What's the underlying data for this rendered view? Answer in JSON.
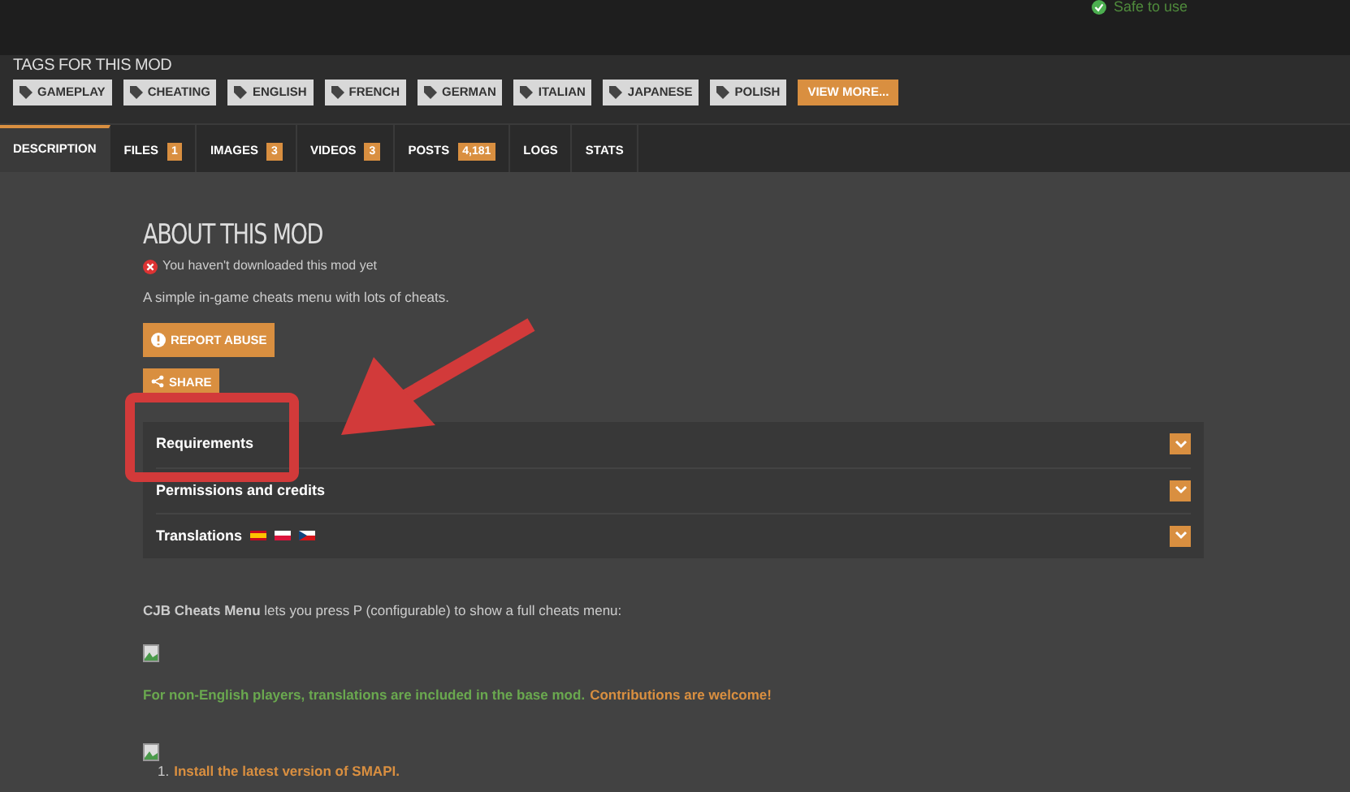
{
  "header": {
    "safety": "Safe to use"
  },
  "tags": {
    "title": "TAGS FOR THIS MOD",
    "items": [
      "GAMEPLAY",
      "CHEATING",
      "ENGLISH",
      "FRENCH",
      "GERMAN",
      "ITALIAN",
      "JAPANESE",
      "POLISH"
    ],
    "more": "VIEW MORE..."
  },
  "tabs": [
    {
      "label": "DESCRIPTION",
      "selected": true
    },
    {
      "label": "FILES",
      "count": "1",
      "selected": false
    },
    {
      "label": "IMAGES",
      "count": "3",
      "selected": false
    },
    {
      "label": "VIDEOS",
      "count": "3",
      "selected": false
    },
    {
      "label": "POSTS",
      "count": "4,181",
      "selected": false
    },
    {
      "label": "LOGS",
      "selected": false
    },
    {
      "label": "STATS",
      "selected": false
    }
  ],
  "about": {
    "title": "ABOUT THIS MOD",
    "download_status": "You haven't downloaded this mod yet",
    "summary": "A simple in-game cheats menu with lots of cheats.",
    "buttons": [
      "REPORT ABUSE",
      "SHARE"
    ]
  },
  "sections": [
    {
      "label": "Requirements",
      "kind": "plain",
      "expanded": false
    },
    {
      "label": "Permissions and credits",
      "kind": "plain",
      "expanded": false
    },
    {
      "label": "Translations",
      "kind": "flags",
      "expanded": false
    }
  ],
  "description": {
    "intro": "**CJB Cheats Menu** lets you press P (configurable) to show a full cheats menu:",
    "note": "For non-English players, translations are included in the base mod.",
    "note_link": "Contributions are welcome!",
    "steps": [
      {
        "number": "1.",
        "text": "Install the latest version of SMAPI.",
        "kind": "link"
      }
    ]
  },
  "annotation": {
    "highlight": true
  }
}
